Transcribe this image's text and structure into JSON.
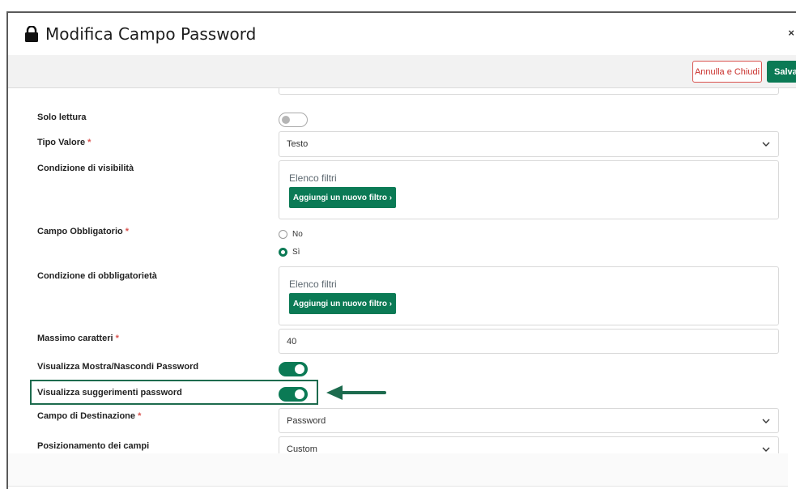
{
  "header": {
    "title": "Modifica Campo Password",
    "close_label": "×",
    "lock_icon": "lock-icon"
  },
  "toolbar": {
    "cancel_label": "Annulla e Chiudi",
    "save_label": "Salva"
  },
  "form": {
    "solo_lettura": {
      "label": "Solo lettura",
      "checked": false
    },
    "tipo_valore": {
      "label": "Tipo Valore",
      "required": "*",
      "value": "Testo"
    },
    "condizione_visibilita": {
      "label": "Condizione di visibilità",
      "filter_title": "Elenco filtri",
      "add_button": "Aggiungi un nuovo filtro ›"
    },
    "campo_obbligatorio": {
      "label": "Campo Obbligatorio",
      "required": "*",
      "options": [
        "No",
        "Sì"
      ],
      "selected": "Sì"
    },
    "condizione_obbligatorieta": {
      "label": "Condizione di obbligatorietà",
      "filter_title": "Elenco filtri",
      "add_button": "Aggiungi un nuovo filtro ›"
    },
    "massimo_caratteri": {
      "label": "Massimo caratteri",
      "required": "*",
      "value": "40"
    },
    "visualizza_mostra": {
      "label": "Visualizza Mostra/Nascondi Password",
      "checked": true
    },
    "visualizza_suggerimenti": {
      "label": "Visualizza suggerimenti password",
      "checked": true
    },
    "campo_destinazione": {
      "label": "Campo di Destinazione",
      "required": "*",
      "value": "Password"
    },
    "posizionamento": {
      "label": "Posizionamento dei campi",
      "value": "Custom"
    }
  },
  "colors": {
    "accent": "#0b7a55",
    "danger": "#d9534f",
    "highlight_border": "#1d6b4e"
  }
}
